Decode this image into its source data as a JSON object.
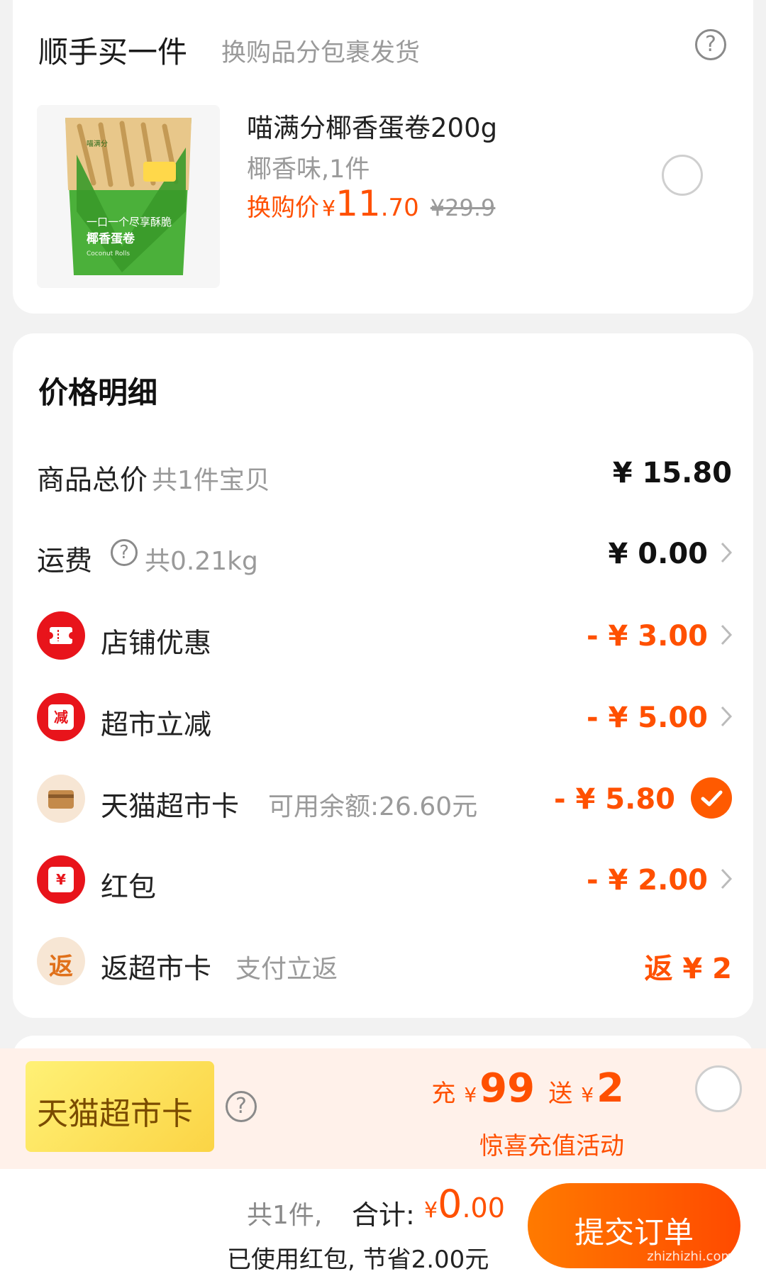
{
  "addon": {
    "title": "顺手买一件",
    "subtitle": "换购品分包裹发货",
    "help_symbol": "?",
    "product": {
      "name": "喵满分椰香蛋卷200g",
      "spec": "椰香味,1件",
      "price_label": "换购价",
      "currency": "¥",
      "price_int": "11",
      "price_dec": ".70",
      "old_price": "¥29.9",
      "package_tagline": "一口一个尽享酥脆",
      "package_name": "椰香蛋卷",
      "package_en": "Coconut Rolls",
      "package_brand": "喵满分"
    }
  },
  "price_detail": {
    "title": "价格明细",
    "rows": {
      "goods": {
        "label": "商品总价",
        "sub": "共1件宝贝",
        "value": "¥ 15.80"
      },
      "shipping": {
        "label": "运费",
        "help": "?",
        "sub": "共0.21kg",
        "value": "¥ 0.00"
      },
      "shop_discount": {
        "label": "店铺优惠",
        "value": "- ¥ 3.00"
      },
      "market_discount": {
        "label": "超市立减",
        "icon_text": "减",
        "value": "- ¥ 5.00"
      },
      "market_card": {
        "label": "天猫超市卡",
        "sub": "可用余额:26.60元",
        "value": "- ¥ 5.80"
      },
      "red_packet": {
        "label": "红包",
        "icon_text": "¥",
        "value": "- ¥ 2.00"
      },
      "cashback": {
        "label": "返超市卡",
        "icon_text": "返",
        "sub": "支付立返",
        "value": "返 ¥ 2"
      }
    }
  },
  "promo": {
    "badge": "天猫超市卡",
    "help": "?",
    "charge_word": "充",
    "currency": "¥",
    "charge_amount": "99",
    "gift_word": "送",
    "gift_amount": "2",
    "caption": "惊喜充值活动"
  },
  "bottom_bar": {
    "count": "共1件,",
    "total_label": "合计:",
    "currency": "¥",
    "total_int": "0",
    "total_dec": ".00",
    "savings": "已使用红包, 节省2.00元",
    "submit": "提交订单",
    "watermark": "zhizhizhi.com"
  },
  "colors": {
    "accent": "#ff5000",
    "red_icon": "#e8141b",
    "promo_bg": "#fff1ea",
    "badge_gold": "#fbd445"
  }
}
